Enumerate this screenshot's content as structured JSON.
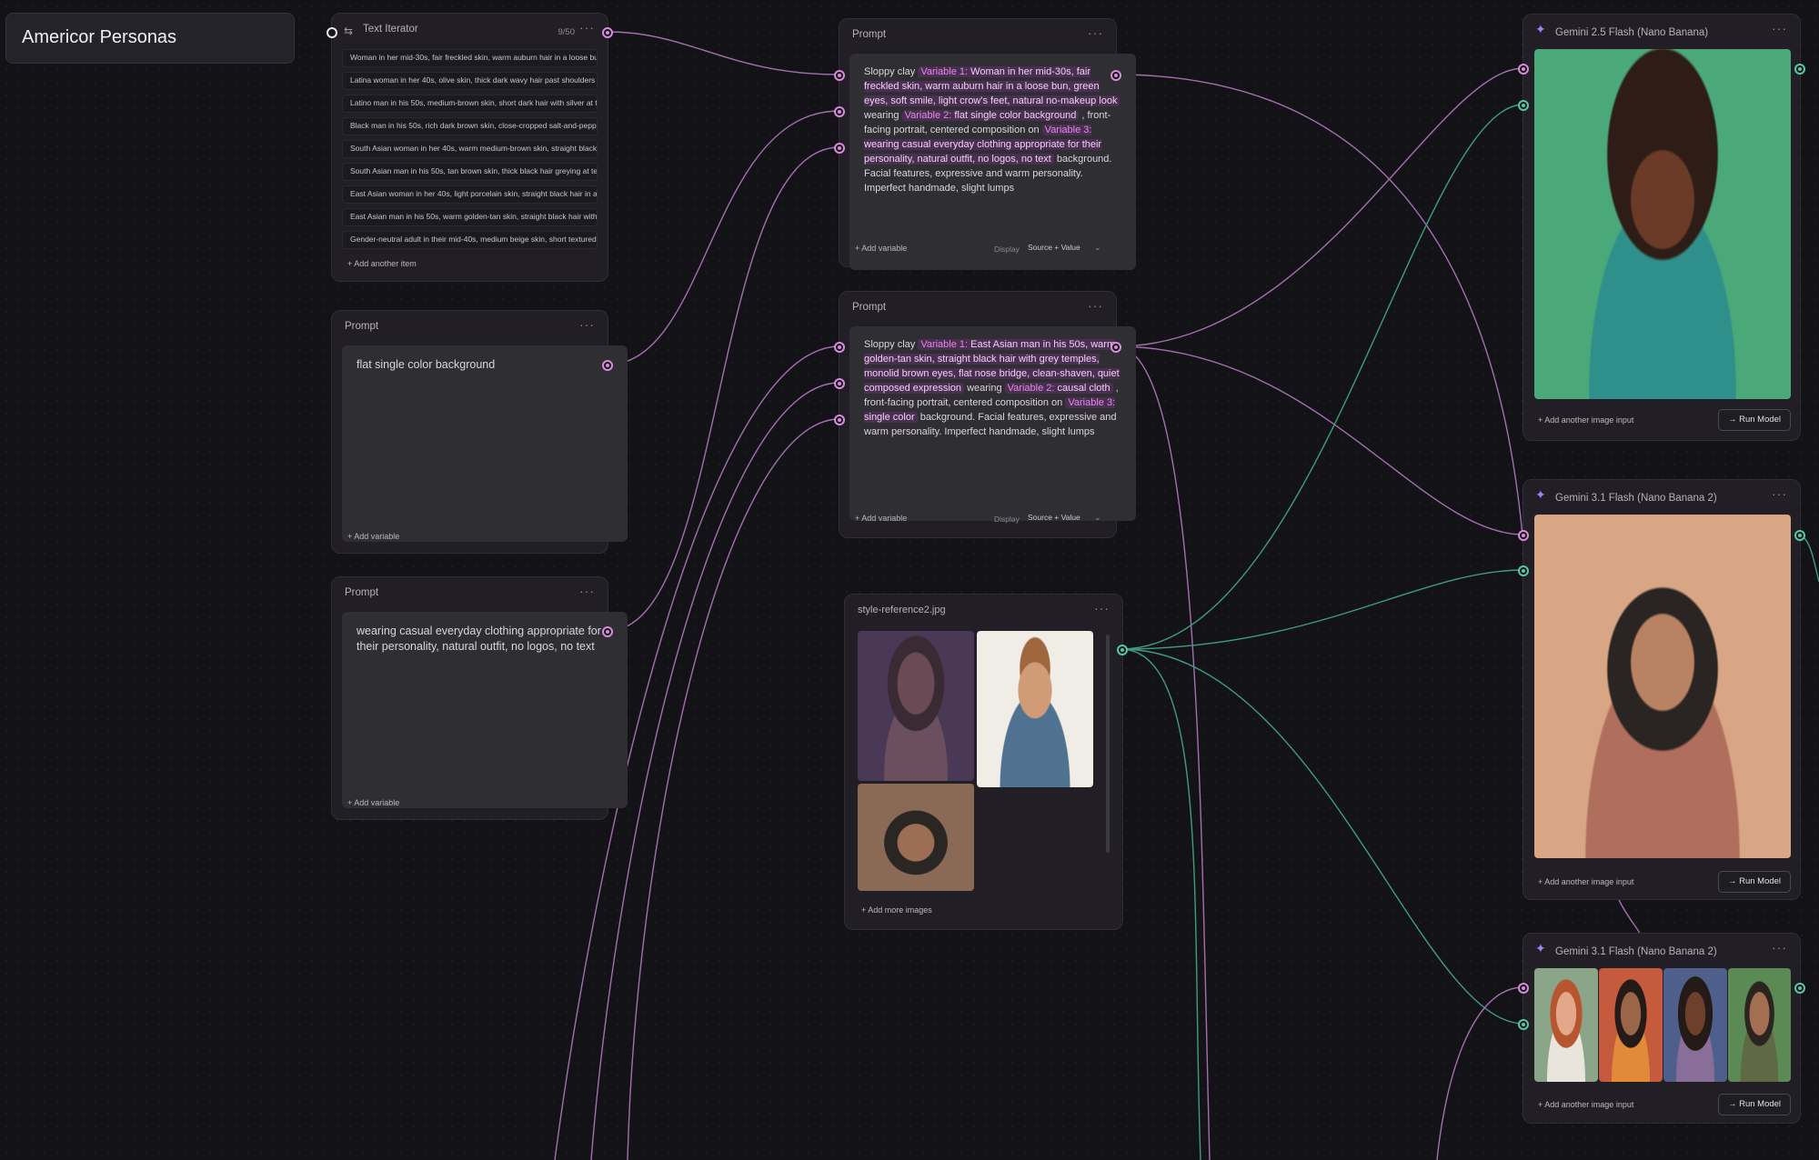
{
  "canvas": {
    "title": "Americor Personas"
  },
  "iterator": {
    "title": "Text Iterator",
    "count": "9/50",
    "items": [
      "Woman in her mid-30s, fair freckled skin, warm auburn hair in a loose bun",
      "Latina woman in her 40s, olive skin, thick dark wavy hair past shoulders",
      "Latino man in his 50s, medium-brown skin, short dark hair with silver at temples",
      "Black man in his 50s, rich dark brown skin, close-cropped salt-and-pepper hair",
      "South Asian woman in her 40s, warm medium-brown skin, straight black hair",
      "South Asian man in his 50s, tan brown skin, thick black hair greying at temples",
      "East Asian woman in her 40s, light porcelain skin, straight black hair in a bob",
      "East Asian man in his 50s, warm golden-tan skin, straight black hair with grey",
      "Gender-neutral adult in their mid-40s, medium beige skin, short textured hair"
    ],
    "add_label": "Add another item"
  },
  "prompt_bg": {
    "title": "Prompt",
    "text": "flat single color background",
    "add_label": "Add variable"
  },
  "prompt_clothing": {
    "title": "Prompt",
    "text": "wearing casual everyday clothing appropriate for their personality, natural outfit, no logos, no text",
    "add_label": "Add variable"
  },
  "prompt_main1": {
    "title": "Prompt",
    "p1": "Sloppy clay ",
    "v1_label": "Variable 1:",
    "v1_value": " Woman in her mid-30s, fair freckled skin, warm auburn hair in a loose bun, green eyes, soft smile, light crow's feet, natural no-makeup look",
    "p2": " wearing ",
    "v2_label": "Variable 2:",
    "v2_value": " flat single color background",
    "p3": " , front-facing portrait, centered composition on ",
    "v3_label": "Variable 3:",
    "v3_value": " wearing casual everyday clothing appropriate for their personality, natural outfit, no logos, no text",
    "p4": " background. Facial features, expressive and warm personality.  Imperfect handmade, slight lumps",
    "add_label": "Add variable",
    "display_label": "Display",
    "display_value": "Source + Value"
  },
  "prompt_main2": {
    "title": "Prompt",
    "p1": "Sloppy clay ",
    "v1_label": "Variable 1:",
    "v1_value": " East Asian man in his 50s, warm golden-tan skin, straight black hair with grey temples, monolid brown eyes, flat nose bridge, clean-shaven, quiet composed expression",
    "p2": " wearing ",
    "v2_label": "Variable 2:",
    "v2_value": " causal cloth",
    "p3": " , front-facing portrait, centered composition on ",
    "v3_label": "Variable 3:",
    "v3_value": " single color",
    "p4": " background. Facial features, expressive and warm personality. Imperfect handmade, slight lumps",
    "add_label": "Add variable",
    "display_label": "Display",
    "display_value": "Source + Value"
  },
  "style_ref": {
    "title": "style-reference2.jpg",
    "add_label": "+ Add more images"
  },
  "model1": {
    "title": "Gemini 2.5 Flash (Nano Banana)",
    "add_label": "Add another image input",
    "run_label": "Run Model"
  },
  "model2": {
    "title": "Gemini 3.1 Flash (Nano Banana 2)",
    "add_label": "Add another image input",
    "run_label": "Run Model"
  },
  "model3": {
    "title": "Gemini 3.1 Flash (Nano Banana 2)",
    "add_label": "Add another image input",
    "run_label": "Run Model"
  },
  "colors": {
    "pink_port": "#d98bdb",
    "green_port": "#55c8a4",
    "background": "#131217",
    "node": "#211f25"
  }
}
